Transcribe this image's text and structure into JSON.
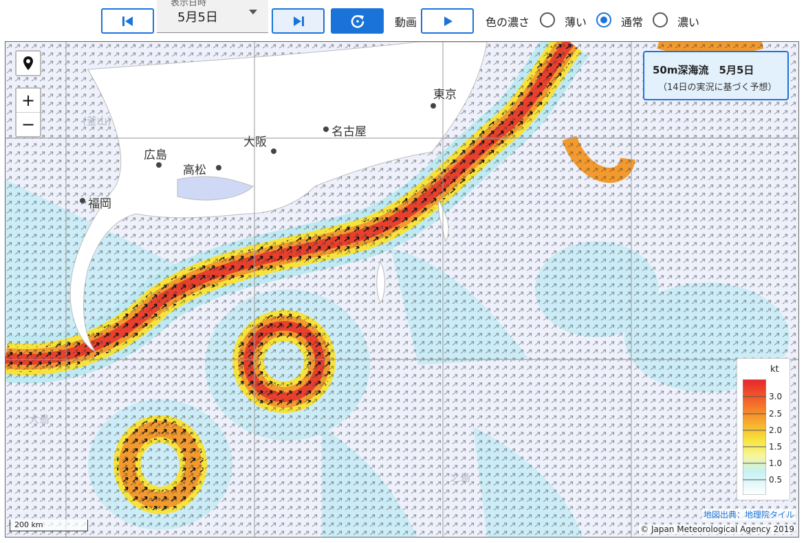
{
  "toolbar": {
    "date_label": "表示日時",
    "date_value": "5月5日",
    "movie_label": "動画",
    "density_label": "色の濃さ",
    "density_options": [
      {
        "label": "薄い",
        "selected": false
      },
      {
        "label": "通常",
        "selected": true
      },
      {
        "label": "濃い",
        "selected": false
      }
    ],
    "icons": {
      "prev": "skip-previous-icon",
      "next": "skip-next-icon",
      "refresh": "refresh-icon",
      "play": "play-icon"
    },
    "accent_color": "#1a73d9"
  },
  "map": {
    "cities": [
      "東京",
      "名古屋",
      "大阪",
      "広島",
      "高松",
      "福岡"
    ],
    "faint_labels": [
      "(釜山)",
      "大島",
      "之島"
    ],
    "info_title": "50m深海流　5月5日",
    "info_sub": "（14日の実況に基づく予想）",
    "legend": {
      "unit": "kt",
      "ticks": [
        "3.0",
        "2.5",
        "2.0",
        "1.5",
        "1.0",
        "0.5"
      ],
      "colors": [
        "#e8252c",
        "#f36a2a",
        "#f7ae2e",
        "#f7e33b",
        "#f7f59a",
        "#c5f2f4",
        "#ffffff"
      ]
    },
    "scale_label": "200 km",
    "attribution_link": "地図出典：地理院タイル",
    "copyright": "© Japan Meteorological Agency 2019",
    "zoom_in": "+",
    "zoom_out": "−"
  }
}
